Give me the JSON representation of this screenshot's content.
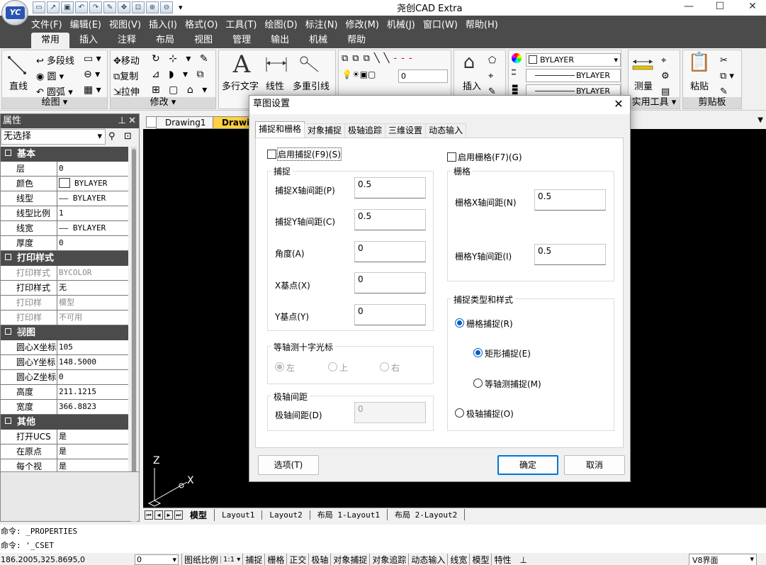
{
  "app": {
    "title": "尧创CAD Extra",
    "logo": "YC"
  },
  "menu": [
    "文件(F)",
    "编辑(E)",
    "视图(V)",
    "插入(I)",
    "格式(O)",
    "工具(T)",
    "绘图(D)",
    "标注(N)",
    "修改(M)",
    "机械(J)",
    "窗口(W)",
    "帮助(H)"
  ],
  "ribbon_tabs": [
    "常用",
    "插入",
    "注释",
    "布局",
    "视图",
    "管理",
    "输出",
    "机械",
    "帮助"
  ],
  "ribbon": {
    "draw": {
      "line": "直线",
      "polyline": "多段线",
      "circle": "圆",
      "arc": "圆弧",
      "label": "绘图"
    },
    "modify": {
      "move": "移动",
      "copy": "复制",
      "stretch": "拉伸",
      "label": "修改"
    },
    "annot": {
      "mtext": "多行文字",
      "linear": "线性",
      "mleader": "多重引线"
    },
    "layer": {
      "current": "0"
    },
    "block": {
      "insert": "插入"
    },
    "props": {
      "color": "BYLAYER",
      "linetype": "BYLAYER",
      "lineweight": "BYLAYER"
    },
    "utils": {
      "measure": "测量",
      "label": "实用工具"
    },
    "clipboard": {
      "paste": "粘贴",
      "label": "剪贴板"
    }
  },
  "properties_panel": {
    "title": "属性",
    "selection": "无选择",
    "categories": [
      {
        "name": "基本",
        "rows": [
          [
            "层",
            "0"
          ],
          [
            "颜色",
            "BYLAYER"
          ],
          [
            "线型",
            "—— BYLAYER"
          ],
          [
            "线型比例",
            "1"
          ],
          [
            "线宽",
            "—— BYLAYER"
          ],
          [
            "厚度",
            "0"
          ]
        ]
      },
      {
        "name": "打印样式",
        "rows": [
          [
            "打印样式",
            "BYCOLOR"
          ],
          [
            "打印样式表",
            "无"
          ],
          [
            "打印样式...",
            "模型"
          ],
          [
            "打印样式...",
            "不可用"
          ]
        ]
      },
      {
        "name": "视图",
        "rows": [
          [
            "圆心X坐标",
            "105"
          ],
          [
            "圆心Y坐标",
            "148.5000"
          ],
          [
            "圆心Z坐标",
            "0"
          ],
          [
            "高度",
            "211.1215"
          ],
          [
            "宽度",
            "366.8823"
          ]
        ]
      },
      {
        "name": "其他",
        "rows": [
          [
            "打开UCS图标",
            "是"
          ],
          [
            "在原点显...",
            "是"
          ],
          [
            "每个视口...",
            "是"
          ]
        ]
      }
    ]
  },
  "doc_tabs": [
    "Drawing1",
    "Drawing"
  ],
  "ucs": {
    "z": "Z",
    "x": "X"
  },
  "layout_tabs": [
    "模型",
    "Layout1",
    "Layout2",
    "布局 1-Layout1",
    "布局 2-Layout2"
  ],
  "command_lines": [
    "命令: _PROPERTIES",
    "命令: '_CSET"
  ],
  "status": {
    "coords": "186.2005,325.8695,0",
    "scale_combo": "0",
    "paper_scale": "图纸比例",
    "ratio": "1:1",
    "toggles": [
      "捕捉",
      "栅格",
      "正交",
      "极轴",
      "对象捕捉",
      "对象追踪",
      "动态输入",
      "线宽",
      "模型",
      "特性"
    ],
    "ui_mode": "V8界面"
  },
  "dialog": {
    "title": "草图设置",
    "tabs": [
      "捕捉和栅格",
      "对象捕捉",
      "极轴追踪",
      "三维设置",
      "动态输入"
    ],
    "enable_snap": "启用捕捉(F9)(S)",
    "enable_grid": "启用栅格(F7)(G)",
    "snap_group": "捕捉",
    "snap_x_label": "捕捉X轴间距(P)",
    "snap_x": "0.5",
    "snap_y_label": "捕捉Y轴间距(C)",
    "snap_y": "0.5",
    "angle_label": "角度(A)",
    "angle": "0",
    "xbase_label": "X基点(X)",
    "xbase": "0",
    "ybase_label": "Y基点(Y)",
    "ybase": "0",
    "iso_group": "等轴测十字光标",
    "iso_left": "左",
    "iso_top": "上",
    "iso_right": "右",
    "polar_group": "极轴间距",
    "polar_label": "极轴间距(D)",
    "polar": "0",
    "grid_group": "栅格",
    "grid_x_label": "栅格X轴间距(N)",
    "grid_x": "0.5",
    "grid_y_label": "栅格Y轴间距(I)",
    "grid_y": "0.5",
    "type_group": "捕捉类型和样式",
    "grid_snap": "栅格捕捉(R)",
    "rect_snap": "矩形捕捉(E)",
    "iso_snap": "等轴测捕捉(M)",
    "polar_snap": "极轴捕捉(O)",
    "options": "选项(T)",
    "ok": "确定",
    "cancel": "取消"
  }
}
